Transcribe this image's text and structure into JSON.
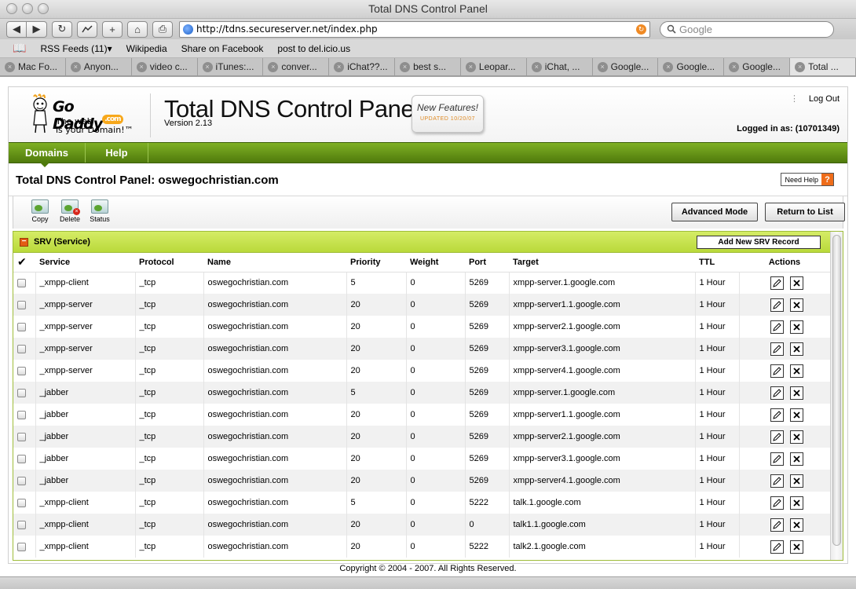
{
  "window": {
    "title": "Total DNS Control Panel"
  },
  "toolbar": {
    "back_icon": "◀",
    "forward_icon": "▶",
    "reload_icon": "↻",
    "add_icon": "+",
    "home_icon": "⌂",
    "print_icon": "⎙",
    "url": "http://tdns.secureserver.net/index.php",
    "search_placeholder": "Google"
  },
  "bookmarks": [
    {
      "label": "RSS Feeds (11)▾"
    },
    {
      "label": "Wikipedia"
    },
    {
      "label": "Share on Facebook"
    },
    {
      "label": "post to del.icio.us"
    }
  ],
  "tabs": [
    {
      "label": "Mac Fo..."
    },
    {
      "label": "Anyon..."
    },
    {
      "label": "video c..."
    },
    {
      "label": "iTunes:..."
    },
    {
      "label": "conver..."
    },
    {
      "label": "iChat??..."
    },
    {
      "label": "best s..."
    },
    {
      "label": "Leopar..."
    },
    {
      "label": "iChat, ..."
    },
    {
      "label": "Google..."
    },
    {
      "label": "Google..."
    },
    {
      "label": "Google..."
    },
    {
      "label": "Total ..."
    }
  ],
  "header": {
    "logo_name": "Go Daddy",
    "logo_com": ".com",
    "logo_tag1": "The web",
    "logo_tag2": "is your Domain!™",
    "app_title": "Total DNS Control Panel",
    "version": "Version 2.13",
    "new_features": "New Features!",
    "updated": "UPDATED 10/20/07",
    "logout": "Log Out",
    "logged_in": "Logged in as: (10701349)"
  },
  "nav": {
    "domains": "Domains",
    "help": "Help"
  },
  "panel": {
    "title": "Total DNS Control Panel: oswegochristian.com",
    "need_help": "Need Help",
    "need_help_q": "?"
  },
  "tools": {
    "copy": "Copy",
    "delete": "Delete",
    "status": "Status",
    "advanced_mode": "Advanced Mode",
    "return_to_list": "Return to List"
  },
  "grid": {
    "section_title": "SRV (Service)",
    "add_button": "Add New SRV Record",
    "columns": [
      "Service",
      "Protocol",
      "Name",
      "Priority",
      "Weight",
      "Port",
      "Target",
      "TTL",
      "Actions"
    ],
    "rows": [
      [
        "_xmpp-client",
        "_tcp",
        "oswegochristian.com",
        "5",
        "0",
        "5269",
        "xmpp-server.1.google.com",
        "1 Hour"
      ],
      [
        "_xmpp-server",
        "_tcp",
        "oswegochristian.com",
        "20",
        "0",
        "5269",
        "xmpp-server1.1.google.com",
        "1 Hour"
      ],
      [
        "_xmpp-server",
        "_tcp",
        "oswegochristian.com",
        "20",
        "0",
        "5269",
        "xmpp-server2.1.google.com",
        "1 Hour"
      ],
      [
        "_xmpp-server",
        "_tcp",
        "oswegochristian.com",
        "20",
        "0",
        "5269",
        "xmpp-server3.1.google.com",
        "1 Hour"
      ],
      [
        "_xmpp-server",
        "_tcp",
        "oswegochristian.com",
        "20",
        "0",
        "5269",
        "xmpp-server4.1.google.com",
        "1 Hour"
      ],
      [
        "_jabber",
        "_tcp",
        "oswegochristian.com",
        "5",
        "0",
        "5269",
        "xmpp-server.1.google.com",
        "1 Hour"
      ],
      [
        "_jabber",
        "_tcp",
        "oswegochristian.com",
        "20",
        "0",
        "5269",
        "xmpp-server1.1.google.com",
        "1 Hour"
      ],
      [
        "_jabber",
        "_tcp",
        "oswegochristian.com",
        "20",
        "0",
        "5269",
        "xmpp-server2.1.google.com",
        "1 Hour"
      ],
      [
        "_jabber",
        "_tcp",
        "oswegochristian.com",
        "20",
        "0",
        "5269",
        "xmpp-server3.1.google.com",
        "1 Hour"
      ],
      [
        "_jabber",
        "_tcp",
        "oswegochristian.com",
        "20",
        "0",
        "5269",
        "xmpp-server4.1.google.com",
        "1 Hour"
      ],
      [
        "_xmpp-client",
        "_tcp",
        "oswegochristian.com",
        "5",
        "0",
        "5222",
        "talk.1.google.com",
        "1 Hour"
      ],
      [
        "_xmpp-client",
        "_tcp",
        "oswegochristian.com",
        "20",
        "0",
        "0",
        "talk1.1.google.com",
        "1 Hour"
      ],
      [
        "_xmpp-client",
        "_tcp",
        "oswegochristian.com",
        "20",
        "0",
        "5222",
        "talk2.1.google.com",
        "1 Hour"
      ]
    ]
  },
  "footer": {
    "copyright": "Copyright © 2004 - 2007. All Rights Reserved."
  },
  "colors": {
    "nav_green": "#5f8e14",
    "section_green": "#c8e24a",
    "accent_orange": "#ef6d1a"
  }
}
